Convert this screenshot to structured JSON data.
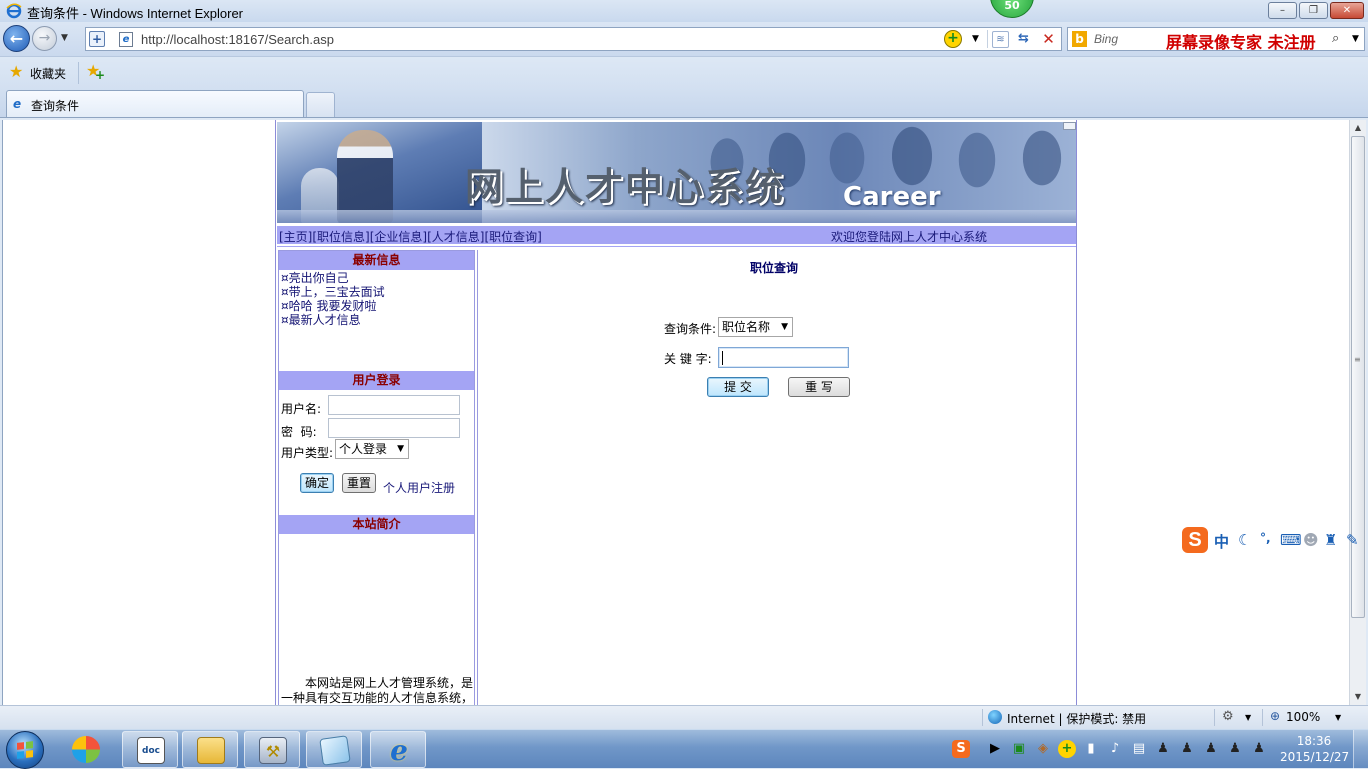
{
  "window": {
    "title": "查询条件 - Windows Internet Explorer",
    "badge": "50",
    "min_label": "–",
    "max_label": "❐",
    "close_label": "✕"
  },
  "address_bar": {
    "url": "http://localhost:18167/Search.asp",
    "search_placeholder": "Bing",
    "search_overlay": "屏幕录像专家  未注册"
  },
  "favorites_bar": {
    "favorites_label": "收藏夹"
  },
  "tabs": [
    {
      "label": "查询条件"
    }
  ],
  "page": {
    "banner_title": "网上人才中心系统",
    "banner_subtitle": "Career",
    "nav_links": [
      "[主页]",
      "[职位信息]",
      "[企业信息]",
      "[人才信息]",
      "[职位查询]"
    ],
    "welcome": "欢迎您登陆网上人才中心系统",
    "news": {
      "heading": "最新信息",
      "items": [
        "¤亮出你自己",
        "¤带上，三宝去面试",
        "¤哈哈 我要发财啦",
        "¤最新人才信息"
      ]
    },
    "login": {
      "heading": "用户登录",
      "username_label": "用户名:",
      "password_label": "密  码:",
      "usertype_label": "用户类型:",
      "usertype_value": "个人登录",
      "confirm_button": "确定",
      "reset_button": "重置",
      "register_link": "个人用户注册"
    },
    "intro": {
      "heading": "本站简介",
      "text": "本网站是网上人才管理系统，是一种具有交互功能的人才信息系统，"
    },
    "search": {
      "heading": "职位查询",
      "condition_label": "查询条件:",
      "condition_value": "职位名称",
      "keyword_label": "关 键 字:",
      "keyword_value": "",
      "submit_button": "提 交",
      "reset_button": "重 写"
    }
  },
  "status_bar": {
    "zone": "Internet | 保护模式: 禁用",
    "zoom": "100%"
  },
  "taskbar": {
    "time": "18:36",
    "date": "2015/12/27"
  },
  "ime": {
    "mode": "中"
  }
}
